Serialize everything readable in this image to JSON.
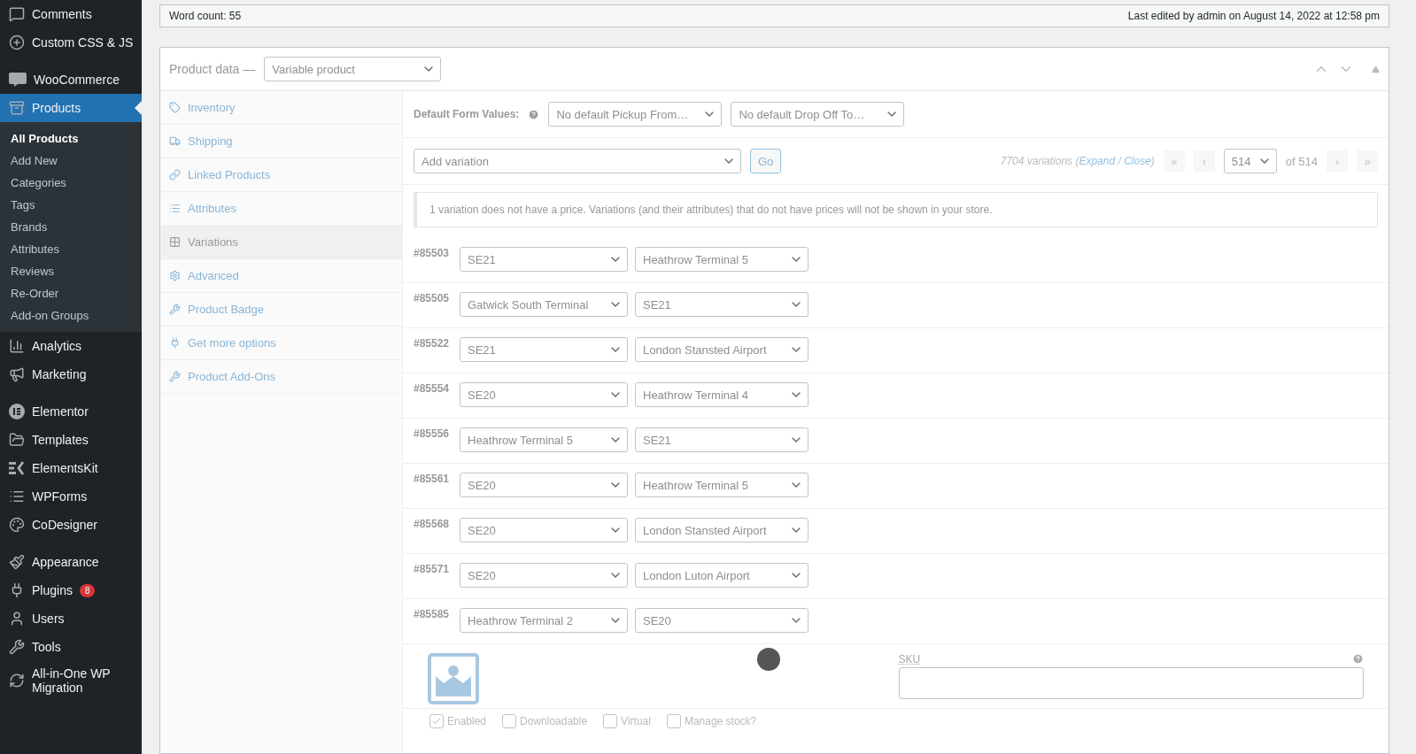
{
  "sidebar": {
    "groups": [
      {
        "items": [
          {
            "label": "Comments",
            "selected": false
          },
          {
            "label": "Custom CSS & JS",
            "selected": false
          }
        ]
      },
      {
        "items": [
          {
            "label": "WooCommerce",
            "selected": false
          },
          {
            "label": "Products",
            "selected": true,
            "children": [
              {
                "label": "All Products",
                "selected": true
              },
              {
                "label": "Add New",
                "selected": false
              },
              {
                "label": "Categories",
                "selected": false
              },
              {
                "label": "Tags",
                "selected": false
              },
              {
                "label": "Brands",
                "selected": false
              },
              {
                "label": "Attributes",
                "selected": false
              },
              {
                "label": "Reviews",
                "selected": false
              },
              {
                "label": "Re-Order",
                "selected": false
              },
              {
                "label": "Add-on Groups",
                "selected": false
              }
            ]
          },
          {
            "label": "Analytics",
            "selected": false
          },
          {
            "label": "Marketing",
            "selected": false
          }
        ]
      },
      {
        "items": [
          {
            "label": "Elementor",
            "selected": false
          },
          {
            "label": "Templates",
            "selected": false
          },
          {
            "label": "ElementsKit",
            "selected": false
          },
          {
            "label": "WPForms",
            "selected": false
          },
          {
            "label": "CoDesigner",
            "selected": false
          }
        ]
      },
      {
        "items": [
          {
            "label": "Appearance",
            "selected": false
          },
          {
            "label": "Plugins",
            "selected": false,
            "badge": "8"
          },
          {
            "label": "Users",
            "selected": false
          },
          {
            "label": "Tools",
            "selected": false
          },
          {
            "label": "All-in-One WP Migration",
            "selected": false
          }
        ]
      }
    ]
  },
  "status_bar": {
    "word_count": "Word count: 55",
    "last_edited": "Last edited by admin on August 14, 2022 at 12:58 pm"
  },
  "product_data": {
    "title": "Product data —",
    "type": "Variable product",
    "tabs": [
      {
        "label": "Inventory",
        "selected": false
      },
      {
        "label": "Shipping",
        "selected": false
      },
      {
        "label": "Linked Products",
        "selected": false
      },
      {
        "label": "Attributes",
        "selected": false
      },
      {
        "label": "Variations",
        "selected": true
      },
      {
        "label": "Advanced",
        "selected": false
      },
      {
        "label": "Product Badge",
        "selected": false
      },
      {
        "label": "Get more options",
        "selected": false
      },
      {
        "label": "Product Add-Ons",
        "selected": false
      }
    ],
    "default_form": {
      "label": "Default Form Values:",
      "selects": [
        "No default Pickup From…",
        "No default Drop Off To…"
      ]
    },
    "add_variation": {
      "value": "Add variation",
      "button": "Go"
    },
    "count": {
      "prefix": "7704 variations (",
      "expand": "Expand",
      "separator": " / ",
      "close": "Close",
      "suffix": ")"
    },
    "pagination": {
      "first": "«",
      "prev": "‹",
      "page": "514",
      "of": "of 514",
      "next": "›",
      "last": "»"
    },
    "notice": "1 variation does not have a price. Variations (and their attributes) that do not have prices will not be shown in your store.",
    "variations": [
      {
        "id": "#85503",
        "from": "SE21",
        "to": "Heathrow Terminal 5"
      },
      {
        "id": "#85505",
        "from": "Gatwick South Terminal",
        "to": "SE21"
      },
      {
        "id": "#85522",
        "from": "SE21",
        "to": "London Stansted Airport"
      },
      {
        "id": "#85554",
        "from": "SE20",
        "to": "Heathrow Terminal 4"
      },
      {
        "id": "#85556",
        "from": "Heathrow Terminal 5",
        "to": "SE21"
      },
      {
        "id": "#85561",
        "from": "SE20",
        "to": "Heathrow Terminal 5"
      },
      {
        "id": "#85568",
        "from": "SE20",
        "to": "London Stansted Airport"
      },
      {
        "id": "#85571",
        "from": "SE20",
        "to": "London Luton Airport"
      },
      {
        "id": "#85585",
        "from": "Heathrow Terminal 2",
        "to": "SE20"
      }
    ],
    "detail": {
      "sku_label": "SKU",
      "options": [
        {
          "label": "Enabled",
          "checked": true
        },
        {
          "label": "Downloadable",
          "checked": false
        },
        {
          "label": "Virtual",
          "checked": false
        },
        {
          "label": "Manage stock?",
          "checked": false
        }
      ]
    }
  }
}
